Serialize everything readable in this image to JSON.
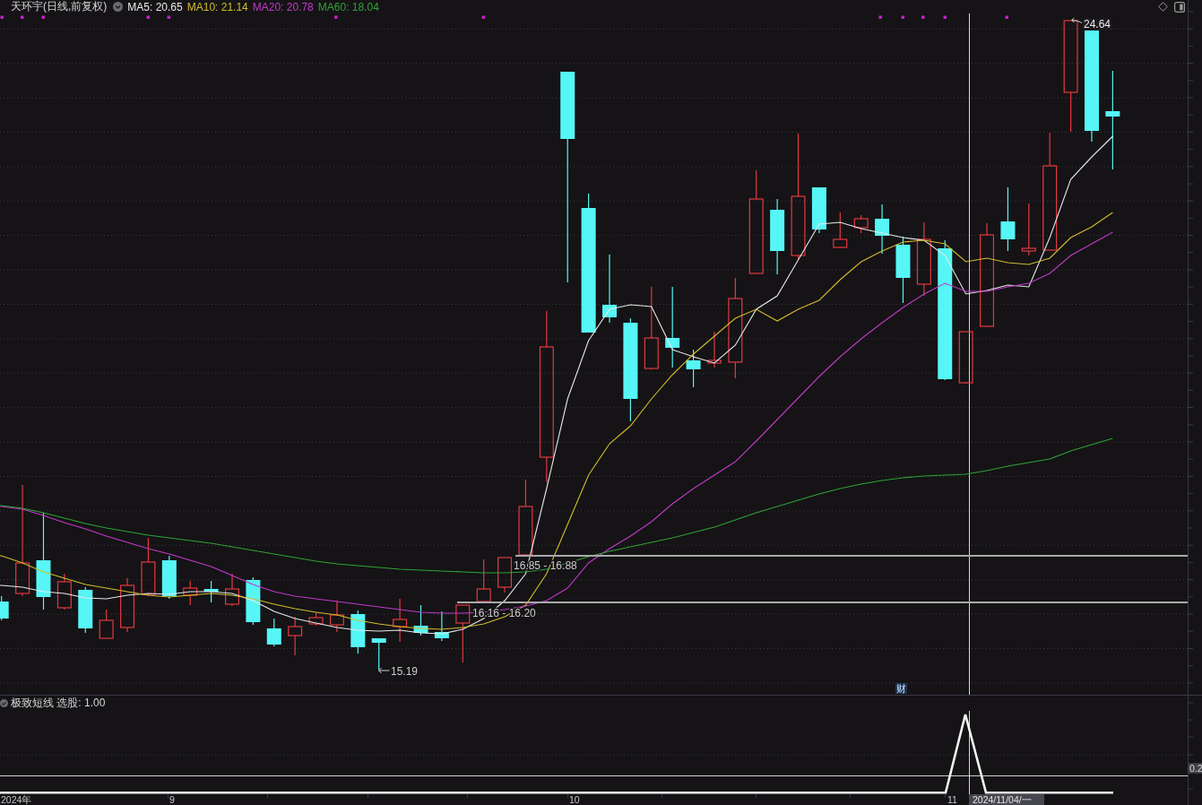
{
  "header": {
    "title": "天环宇(日线,前复权)",
    "legend": [
      {
        "label": "MA5: 20.65",
        "color": "#e8e8e8"
      },
      {
        "label": "MA10: 21.14",
        "color": "#d2bd2c"
      },
      {
        "label": "MA20: 20.78",
        "color": "#c03ac8"
      },
      {
        "label": "MA60: 18.04",
        "color": "#2fa335"
      }
    ]
  },
  "chart_labels": {
    "high": "24.64",
    "low": "15.19",
    "bands": [
      "16.85 - 16.88",
      "16.16 - 16.20"
    ],
    "event_badge": "财"
  },
  "indicator": {
    "title": "极致短线 选股: 1.00",
    "axis_value": "0.2"
  },
  "date_axis": {
    "labels": [
      "2024年",
      "9",
      "10",
      "11"
    ],
    "crosshair_date": "2024/11/04/一"
  }
}
